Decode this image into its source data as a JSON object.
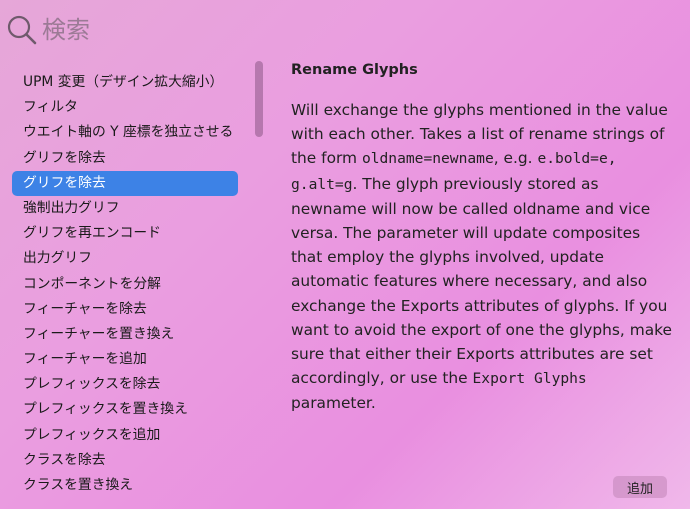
{
  "search": {
    "placeholder": "検索",
    "value": ""
  },
  "list": {
    "items": [
      "UPM 変更（デザイン拡大縮小）",
      "フィルタ",
      "ウエイト軸の Y 座標を独立させる",
      "グリフを除去",
      "グリフを除去",
      "強制出力グリフ",
      "グリフを再エンコード",
      "出力グリフ",
      "コンポーネントを分解",
      "フィーチャーを除去",
      "フィーチャーを置き換え",
      "フィーチャーを追加",
      "プレフィックスを除去",
      "プレフィックスを置き換え",
      "プレフィックスを追加",
      "クラスを除去",
      "クラスを置き換え"
    ],
    "selected_index": 4
  },
  "detail": {
    "title": "Rename Glyphs",
    "t1": "Will exchange the glyphs mentioned in the value with each other. Takes a list of rename strings of the form ",
    "c1": "oldname=newname",
    "t2": ", e.g. ",
    "c2": "e.bold=e, g.alt=g",
    "t3": ". The glyph previously stored as newname will now be called oldname and vice versa. The parameter will update composites that employ the glyphs involved, update automatic features where necessary, and also exchange the Exports attributes of glyphs. If you want to avoid the export of one the glyphs, make sure that either their Exports attributes are set accordingly, or use the ",
    "c3": "Export Glyphs",
    "t4": " parameter."
  },
  "buttons": {
    "add_label": "追加"
  },
  "colors": {
    "selection": "#3d82e6",
    "background": "#e99fe0"
  },
  "icons": {
    "search": "magnifying-glass"
  }
}
